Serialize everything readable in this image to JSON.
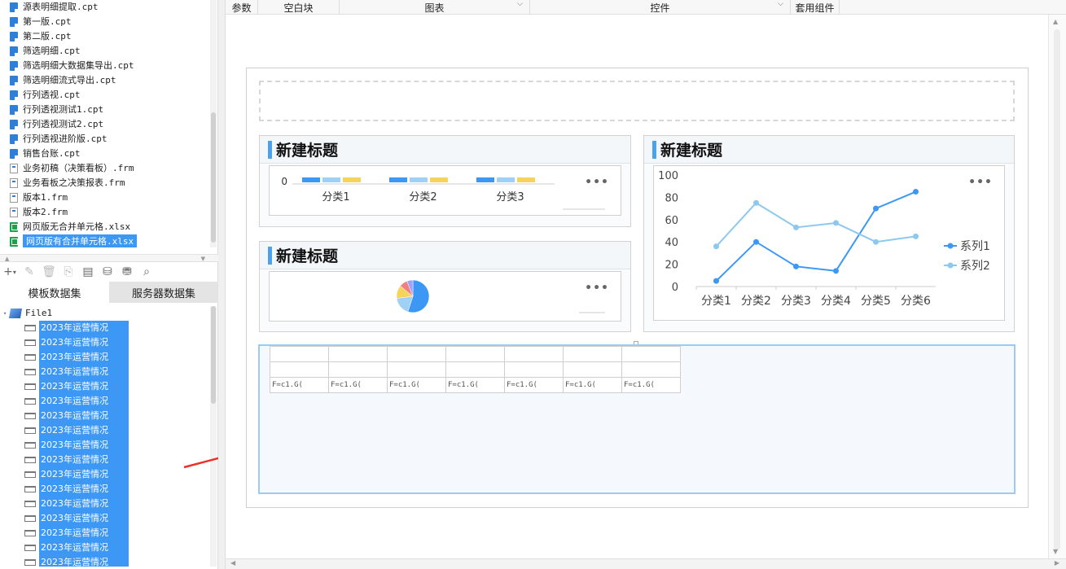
{
  "left_panel": {
    "files": [
      {
        "name": "源表明细提取.cpt",
        "type": "cpt"
      },
      {
        "name": "第一版.cpt",
        "type": "cpt"
      },
      {
        "name": "第二版.cpt",
        "type": "cpt"
      },
      {
        "name": "筛选明细.cpt",
        "type": "cpt"
      },
      {
        "name": "筛选明细大数据集导出.cpt",
        "type": "cpt"
      },
      {
        "name": "筛选明细流式导出.cpt",
        "type": "cpt"
      },
      {
        "name": "行列透视.cpt",
        "type": "cpt"
      },
      {
        "name": "行列透视测试1.cpt",
        "type": "cpt"
      },
      {
        "name": "行列透视测试2.cpt",
        "type": "cpt"
      },
      {
        "name": "行列透视进阶版.cpt",
        "type": "cpt"
      },
      {
        "name": "销售台账.cpt",
        "type": "cpt"
      },
      {
        "name": "业务初稿（决策看板）.frm",
        "type": "frm"
      },
      {
        "name": "业务看板之决策报表.frm",
        "type": "frm"
      },
      {
        "name": "版本1.frm",
        "type": "frm"
      },
      {
        "name": "版本2.frm",
        "type": "frm"
      },
      {
        "name": "网页版无合并单元格.xlsx",
        "type": "xls"
      },
      {
        "name": "网页版有合并单元格.xlsx",
        "type": "xls",
        "selected": true
      }
    ],
    "toolbar_icons": [
      "add-icon",
      "edit-icon",
      "delete-icon",
      "preview-icon",
      "dataset-icon",
      "database-icon",
      "database-link-icon",
      "search-icon"
    ],
    "tabs": {
      "template": "模板数据集",
      "server": "服务器数据集"
    },
    "tree": {
      "root": "File1",
      "items": [
        "2023年运营情况",
        "2023年运营情况",
        "2023年运营情况",
        "2023年运营情况",
        "2023年运营情况",
        "2023年运营情况",
        "2023年运营情况",
        "2023年运营情况",
        "2023年运营情况",
        "2023年运营情况",
        "2023年运营情况",
        "2023年运营情况",
        "2023年运营情况",
        "2023年运营情况",
        "2023年运营情况",
        "2023年运营情况",
        "2023年运营情况"
      ]
    }
  },
  "top_toolbar": {
    "params": "参数",
    "blank": "空白块",
    "chart": "图表",
    "widget": "控件",
    "template_widget": "套用组件"
  },
  "widgets": {
    "bar_title": "新建标题",
    "line_title": "新建标题",
    "pie_title": "新建标题",
    "more": "•••"
  },
  "chart_data": [
    {
      "type": "bar",
      "categories": [
        "分类1",
        "分类2",
        "分类3"
      ],
      "ytick": "0",
      "series": [
        {
          "values": [
            1,
            1,
            1
          ],
          "color": "#3d98f5"
        },
        {
          "values": [
            1,
            1,
            1
          ],
          "color": "#9fd0f5"
        },
        {
          "values": [
            1,
            1,
            1
          ],
          "color": "#f6d35a"
        }
      ]
    },
    {
      "type": "line",
      "categories": [
        "分类1",
        "分类2",
        "分类3",
        "分类4",
        "分类5",
        "分类6"
      ],
      "ylim": [
        0,
        100
      ],
      "yticks": [
        "0",
        "20",
        "40",
        "60",
        "80",
        "100"
      ],
      "legend_position": "right",
      "series": [
        {
          "name": "系列1",
          "color": "#3d98f5",
          "values": [
            5,
            40,
            18,
            14,
            70,
            85
          ]
        },
        {
          "name": "系列2",
          "color": "#8cc8ef",
          "values": [
            36,
            75,
            53,
            57,
            40,
            45
          ]
        }
      ]
    },
    {
      "type": "pie",
      "values": [
        55,
        18,
        13,
        8,
        6
      ],
      "colors": [
        "#3d98f5",
        "#9fd0f5",
        "#f6d35a",
        "#f08080",
        "#a0a0ff"
      ]
    }
  ],
  "report_cells": [
    "F=c1.G(",
    "F=c1.G(",
    "F=c1.G(",
    "F=c1.G(",
    "F=c1.G(",
    "F=c1.G(",
    "F=c1.G("
  ]
}
